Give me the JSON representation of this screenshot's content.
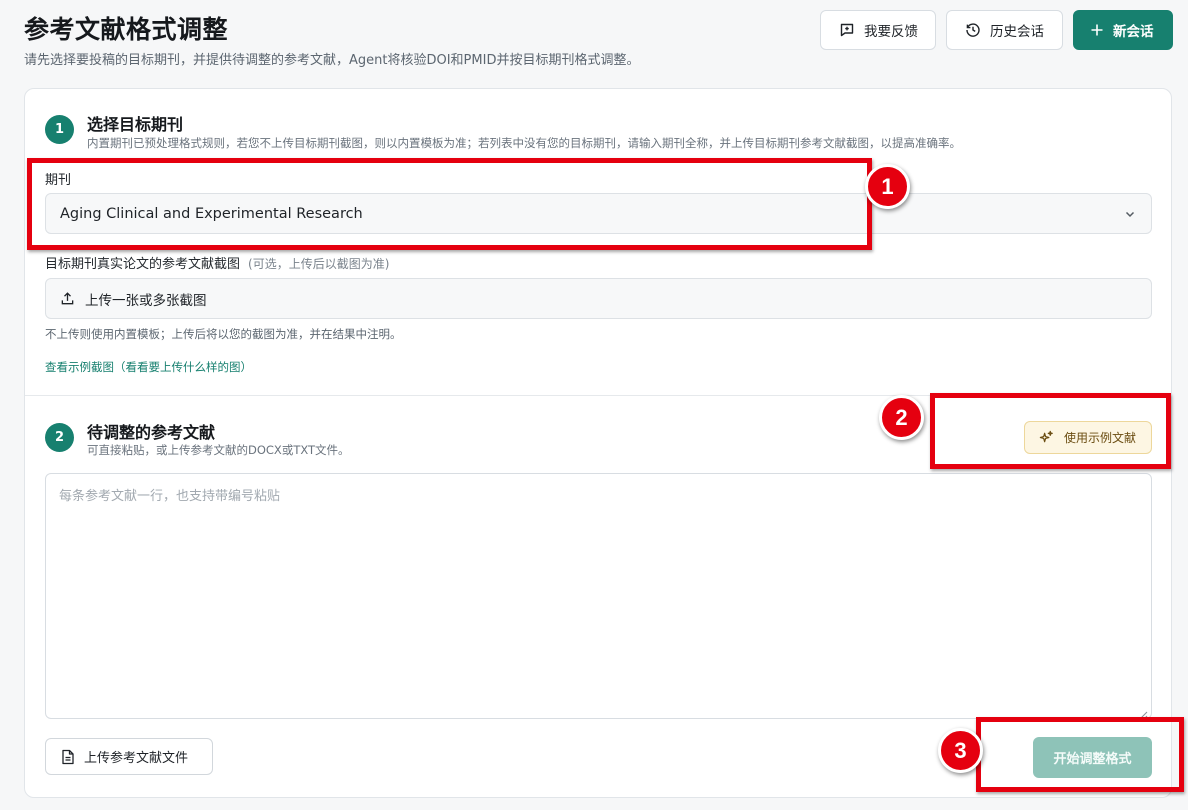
{
  "header": {
    "title": "参考文献格式调整",
    "subtitle": "请先选择要投稿的目标期刊，并提供待调整的参考文献，Agent将核验DOI和PMID并按目标期刊格式调整。",
    "feedback_label": "我要反馈",
    "history_label": "历史会话",
    "new_label": "新会话"
  },
  "step1": {
    "number": "1",
    "title": "选择目标期刊",
    "description": "内置期刊已预处理格式规则，若您不上传目标期刊截图，则以内置模板为准；若列表中没有您的目标期刊，请输入期刊全称，并上传目标期刊参考文献截图，以提高准确率。",
    "journal_label": "期刊",
    "journal_value": "Aging Clinical and Experimental Research",
    "screenshot_label": "目标期刊真实论文的参考文献截图",
    "screenshot_hint": "(可选，上传后以截图为准)",
    "upload_label": "上传一张或多张截图",
    "note": "不上传则使用内置模板；上传后将以您的截图为准，并在结果中注明。",
    "example_link": "查看示例截图（看看要上传什么样的图）"
  },
  "step2": {
    "number": "2",
    "title": "待调整的参考文献",
    "description": "可直接粘贴，或上传参考文献的DOCX或TXT文件。",
    "sample_button": "使用示例文献",
    "textarea_placeholder": "每条参考文献一行，也支持带编号粘贴",
    "upload_file_button": "上传参考文献文件",
    "start_button": "开始调整格式"
  },
  "annotations": [
    "1",
    "2",
    "3"
  ],
  "colors": {
    "primary": "#17806f",
    "primary_disabled": "#8ec3b8",
    "annotation_red": "#e5000f",
    "sample_bg": "#fdf6e3"
  },
  "icons": [
    "feedback-icon",
    "history-icon",
    "plus-icon",
    "chevron-down-icon",
    "upload-icon",
    "sparkle-icon",
    "file-icon"
  ]
}
